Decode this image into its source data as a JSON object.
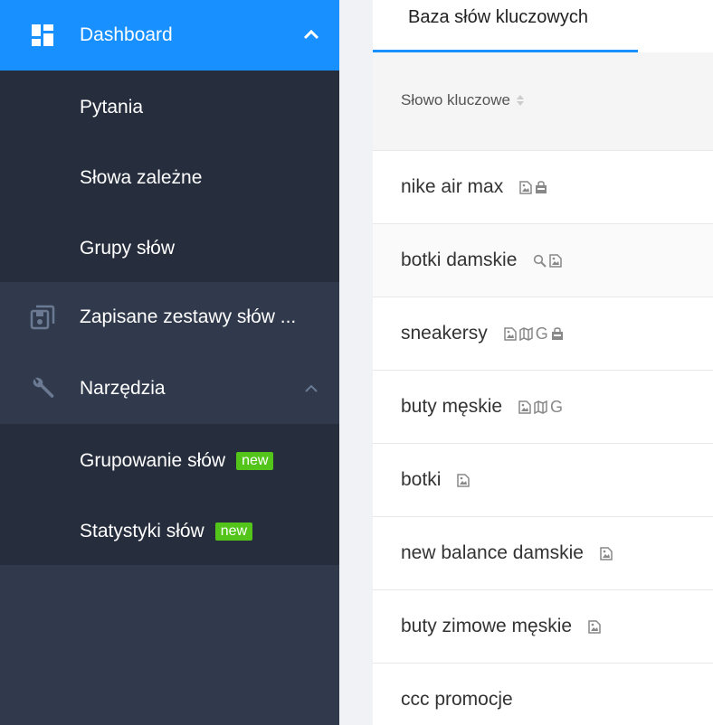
{
  "sidebar": {
    "dashboard": {
      "label": "Dashboard",
      "icon": "dashboard-icon",
      "expanded": true
    },
    "dashboard_sub": [
      {
        "label": "Pytania"
      },
      {
        "label": "Słowa zależne"
      },
      {
        "label": "Grupy słów"
      }
    ],
    "saved": {
      "label": "Zapisane zestawy słów ...",
      "icon": "save-icon"
    },
    "tools": {
      "label": "Narzędzia",
      "icon": "wrench-icon",
      "expanded": true
    },
    "tools_sub": [
      {
        "label": "Grupowanie słów",
        "badge": "new"
      },
      {
        "label": "Statystyki słów",
        "badge": "new"
      }
    ],
    "colors": {
      "active": "#1890ff",
      "bg": "#303a4c",
      "submenu_bg": "#262d3c",
      "badge": "#52c41a"
    }
  },
  "main": {
    "tab": {
      "label": "Baza słów kluczowych",
      "active": true
    },
    "table": {
      "column_header": "Słowo kluczowe",
      "rows": [
        {
          "keyword": "nike air max",
          "icons": [
            "image-icon",
            "shopping-bag-icon"
          ],
          "highlighted": false
        },
        {
          "keyword": "botki damskie",
          "icons": [
            "search-icon",
            "image-icon"
          ],
          "highlighted": true
        },
        {
          "keyword": "sneakersy",
          "icons": [
            "image-icon",
            "map-icon",
            "google-g-icon",
            "shopping-bag-icon"
          ],
          "highlighted": false
        },
        {
          "keyword": "buty męskie",
          "icons": [
            "image-icon",
            "map-icon",
            "google-g-icon"
          ],
          "highlighted": false
        },
        {
          "keyword": "botki",
          "icons": [
            "image-icon"
          ],
          "highlighted": false
        },
        {
          "keyword": "new balance damskie",
          "icons": [
            "image-icon"
          ],
          "highlighted": false
        },
        {
          "keyword": "buty zimowe męskie",
          "icons": [
            "image-icon"
          ],
          "highlighted": false
        },
        {
          "keyword": "ccc promocje",
          "icons": [],
          "highlighted": false
        }
      ]
    }
  }
}
